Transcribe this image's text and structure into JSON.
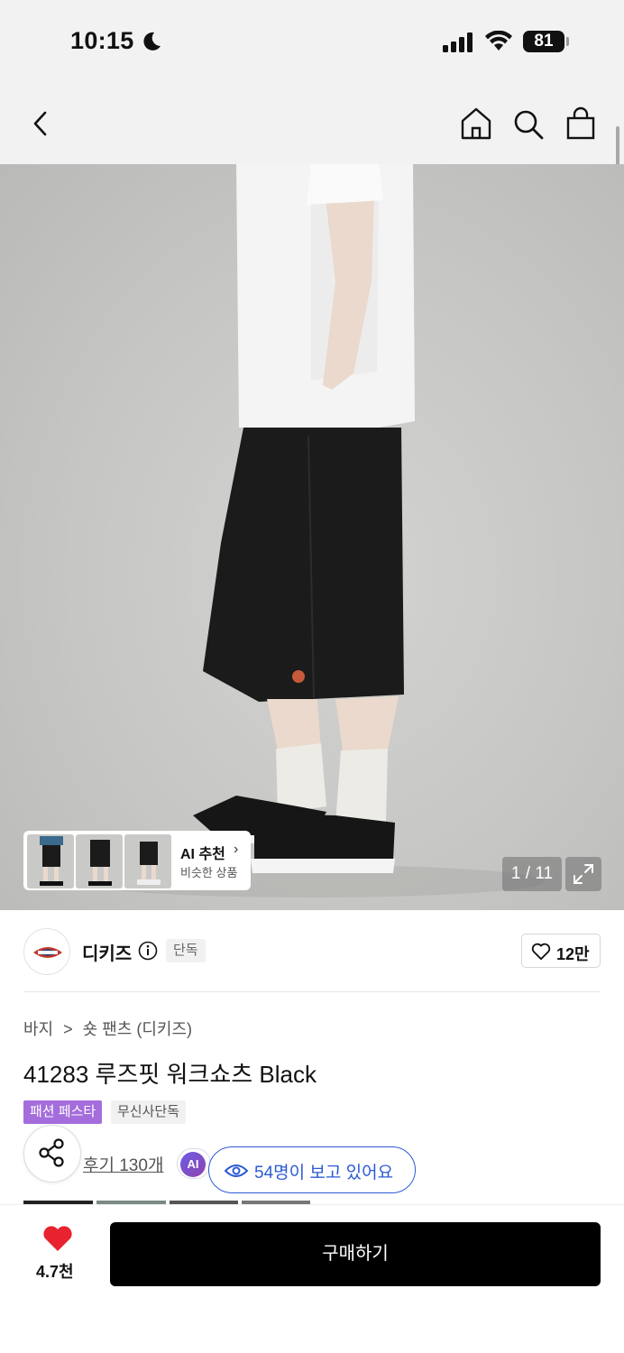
{
  "status_bar": {
    "time": "10:15",
    "battery": "81"
  },
  "nav": {
    "icons": [
      "back-icon",
      "home-icon",
      "search-icon",
      "shopping-bag-icon"
    ]
  },
  "gallery": {
    "counter": "1 / 11",
    "ai_recommend": {
      "title": "AI 추천",
      "subtitle": "비슷한 상품"
    }
  },
  "brand": {
    "name": "디키즈",
    "badge": "단독",
    "likes": "12만"
  },
  "breadcrumb": {
    "category": "바지",
    "separator": ">",
    "subcategory": "숏 팬츠 (디키즈)"
  },
  "product": {
    "title": "41283 루즈핏 워크쇼츠 Black",
    "tags": [
      "패션 페스타",
      "무신사단독"
    ],
    "reviews": "후기 130개",
    "ai_label": "AI",
    "viewers": "54명이 보고 있어요"
  },
  "bottom_bar": {
    "likes": "4.7천",
    "buy_label": "구매하기"
  },
  "colors": {
    "accent_blue": "#2d5bd4",
    "festa_purple": "#a46ddb",
    "heart_red": "#e8222e"
  }
}
